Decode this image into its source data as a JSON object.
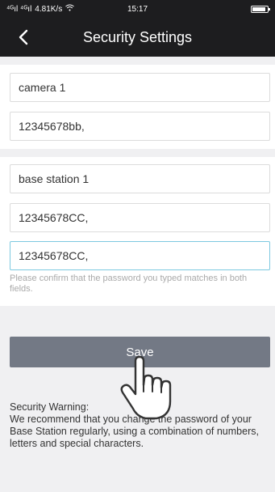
{
  "status_bar": {
    "signal": "⁴ᴳıl ⁴ᴳıl",
    "speed": "4.81K/s",
    "wifi": "wifi-icon",
    "time": "15:17",
    "battery_level": 0.9
  },
  "header": {
    "back_icon": "chevron-left-icon",
    "title": "Security Settings"
  },
  "camera_section": {
    "name_value": "camera 1",
    "password_value": "12345678bb,"
  },
  "base_station_section": {
    "name_value": "base station 1",
    "password_value": "12345678CC,",
    "confirm_value": "12345678CC,",
    "hint": "Please confirm that the password you typed matches in both fields."
  },
  "actions": {
    "save_label": "Save"
  },
  "warning": {
    "title": "Security Warning:",
    "body": "We recommend that you change the password of your Base Station regularly, using a combination of numbers, letters and special characters."
  },
  "colors": {
    "header_bg": "#1d1d1f",
    "save_button_bg": "#737985",
    "focus_border": "#7dc9e0"
  }
}
